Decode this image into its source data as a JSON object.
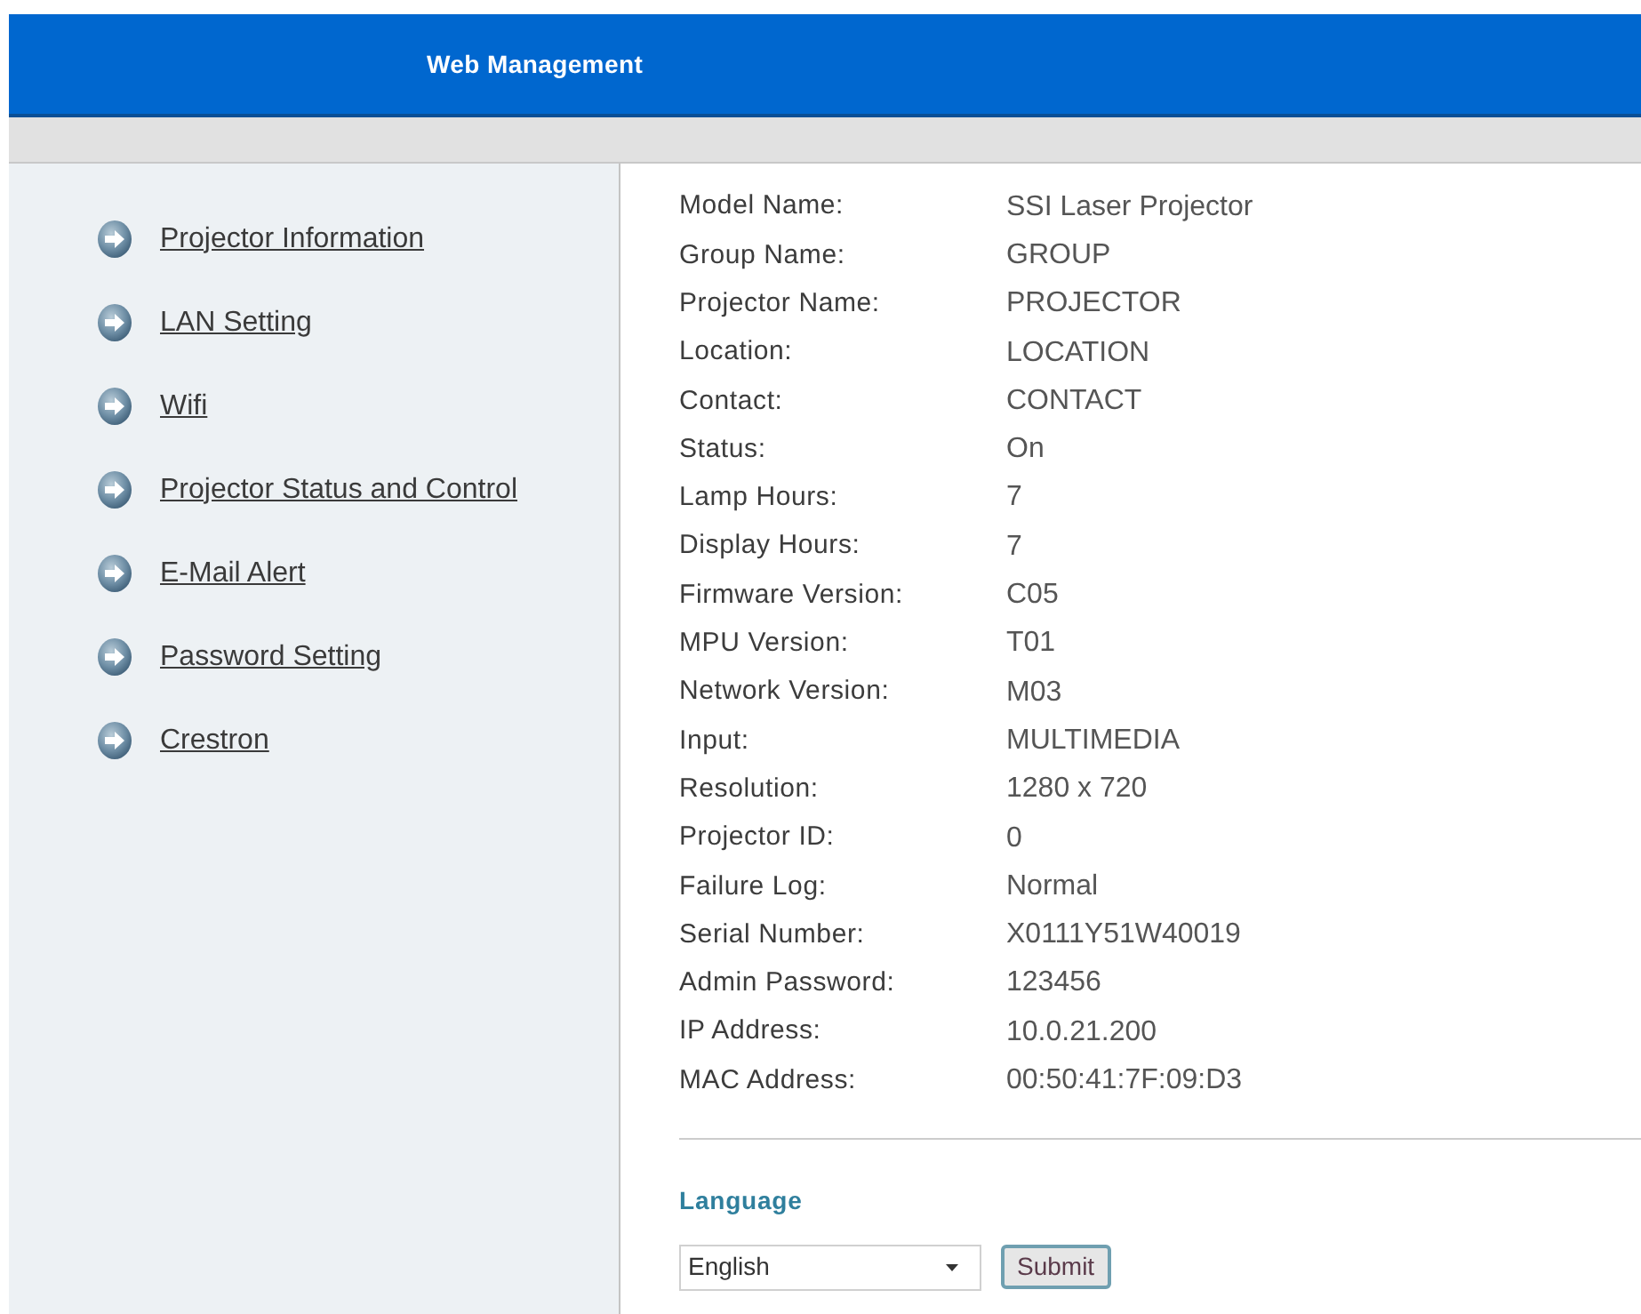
{
  "header": {
    "title": "Web Management"
  },
  "sidebar": {
    "items": [
      {
        "label": "Projector Information"
      },
      {
        "label": "LAN Setting"
      },
      {
        "label": "Wifi"
      },
      {
        "label": "Projector Status and Control"
      },
      {
        "label": "E-Mail Alert"
      },
      {
        "label": "Password Setting"
      },
      {
        "label": "Crestron"
      }
    ]
  },
  "info": {
    "rows": [
      {
        "label": "Model Name:",
        "value": "SSI Laser Projector"
      },
      {
        "label": "Group Name:",
        "value": "GROUP"
      },
      {
        "label": "Projector Name:",
        "value": "PROJECTOR"
      },
      {
        "label": "Location:",
        "value": "LOCATION"
      },
      {
        "label": "Contact:",
        "value": "CONTACT"
      },
      {
        "label": "Status:",
        "value": "On"
      },
      {
        "label": "Lamp Hours:",
        "value": "7"
      },
      {
        "label": "Display Hours:",
        "value": "7"
      },
      {
        "label": "Firmware Version:",
        "value": "C05"
      },
      {
        "label": "MPU Version:",
        "value": "T01"
      },
      {
        "label": "Network Version:",
        "value": "M03"
      },
      {
        "label": "Input:",
        "value": "MULTIMEDIA"
      },
      {
        "label": "Resolution:",
        "value": "1280 x 720"
      },
      {
        "label": "Projector ID:",
        "value": "0"
      },
      {
        "label": "Failure Log:",
        "value": "Normal"
      },
      {
        "label": "Serial Number:",
        "value": "X0111Y51W40019"
      },
      {
        "label": "Admin Password:",
        "value": "123456"
      },
      {
        "label": "IP Address:",
        "value": "10.0.21.200"
      },
      {
        "label": "MAC Address:",
        "value": "00:50:41:7F:09:D3"
      }
    ]
  },
  "language": {
    "heading": "Language",
    "select": {
      "value": "English"
    },
    "submit": "Submit"
  }
}
